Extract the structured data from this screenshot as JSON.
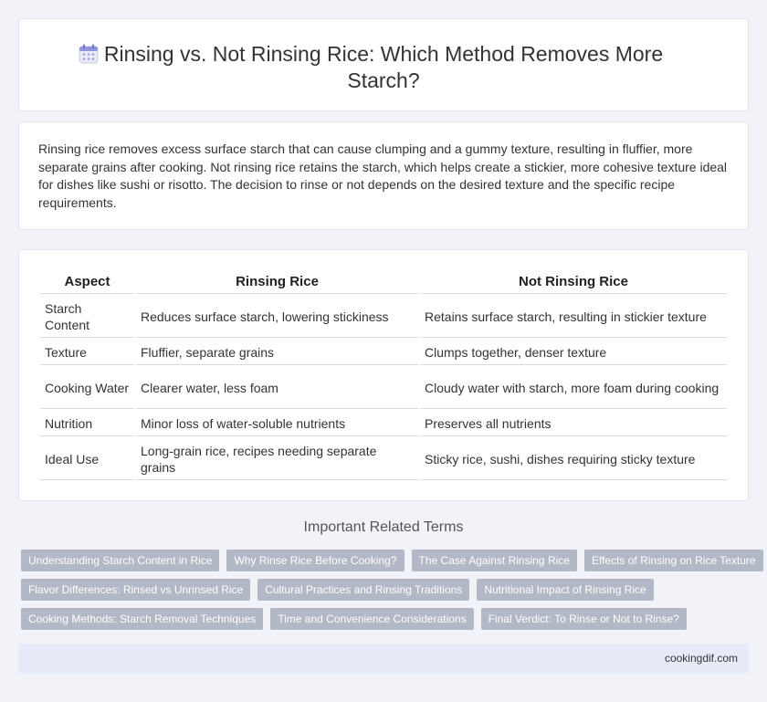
{
  "header": {
    "icon": "calendar-icon",
    "title": "Rinsing vs. Not Rinsing Rice: Which Method Removes More Starch?"
  },
  "intro": {
    "text": "Rinsing rice removes excess surface starch that can cause clumping and a gummy texture, resulting in fluffier, more separate grains after cooking. Not rinsing rice retains the starch, which helps create a stickier, more cohesive texture ideal for dishes like sushi or risotto. The decision to rinse or not depends on the desired texture and the specific recipe requirements."
  },
  "table": {
    "headers": [
      "Aspect",
      "Rinsing Rice",
      "Not Rinsing Rice"
    ],
    "rows": [
      [
        "Starch Content",
        "Reduces surface starch, lowering stickiness",
        "Retains surface starch, resulting in stickier texture"
      ],
      [
        "Texture",
        "Fluffier, separate grains",
        "Clumps together, denser texture"
      ],
      [
        "Cooking Water",
        "Clearer water, less foam",
        "Cloudy water with starch, more foam during cooking"
      ],
      [
        "Nutrition",
        "Minor loss of water-soluble nutrients",
        "Preserves all nutrients"
      ],
      [
        "Ideal Use",
        "Long-grain rice, recipes needing separate grains",
        "Sticky rice, sushi, dishes requiring sticky texture"
      ]
    ]
  },
  "related": {
    "title": "Important Related Terms",
    "rows": [
      [
        "Understanding Starch Content in Rice",
        "Why Rinse Rice Before Cooking?",
        "The Case Against Rinsing Rice",
        "Effects of Rinsing on Rice Texture"
      ],
      [
        "Flavor Differences: Rinsed vs Unrinsed Rice",
        "Cultural Practices and Rinsing Traditions",
        "Nutritional Impact of Rinsing Rice"
      ],
      [
        "Cooking Methods: Starch Removal Techniques",
        "Time and Convenience Considerations",
        "Final Verdict: To Rinse or Not to Rinse?"
      ]
    ]
  },
  "footer": {
    "site": "cookingdif.com"
  },
  "colors": {
    "background": "#f1f3f8",
    "tag": "#b3b8c6",
    "footer": "#e6ebf7"
  }
}
